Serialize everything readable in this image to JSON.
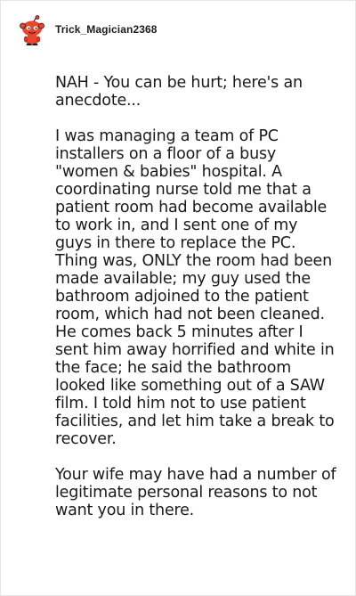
{
  "comment": {
    "author": "Trick_Magician2368",
    "avatar_icon": "reddit-snoo-avatar-icon",
    "accent_color": "#e8452c",
    "paragraphs": [
      "NAH - You can be hurt; here's an anecdote...",
      "I was managing a team of PC installers on a floor of a busy \"women & babies\" hospital. A coordinating nurse told me that a patient room had become available to work in, and I sent one of my guys in there to replace the PC. Thing was, ONLY the room had been made available; my guy used the bathroom adjoined to the patient room, which had not been cleaned. He comes back 5 minutes after I sent him away horrified and white in the face; he said the bathroom looked like something out of a SAW film. I told him not to use patient facilities, and let him take a break to recover.",
      "Your wife may have had a number of legitimate personal reasons to not want you in there."
    ]
  }
}
